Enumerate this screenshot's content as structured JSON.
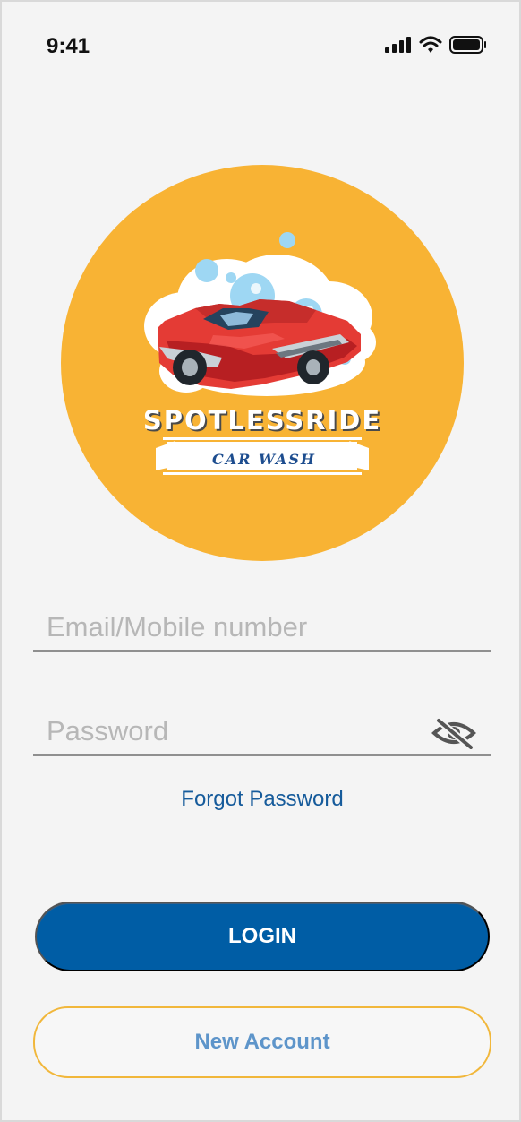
{
  "status": {
    "time": "9:41",
    "icons": [
      "signal-icon",
      "wifi-icon",
      "battery-icon"
    ]
  },
  "logo": {
    "brand_name": "SPOTLESSRIDE",
    "brand_sub": "CAR WASH",
    "circle_color": "#f8b334"
  },
  "form": {
    "email_placeholder": "Email/Mobile number",
    "password_placeholder": "Password",
    "password_toggle_icon": "eye-slash-icon"
  },
  "links": {
    "forgot_password": "Forgot Password"
  },
  "buttons": {
    "login": "LOGIN",
    "new_account": "New Account"
  },
  "colors": {
    "primary": "#005da5",
    "secondary_text": "#5e95ca",
    "accent": "#f1b73b",
    "link": "#165b9b"
  }
}
